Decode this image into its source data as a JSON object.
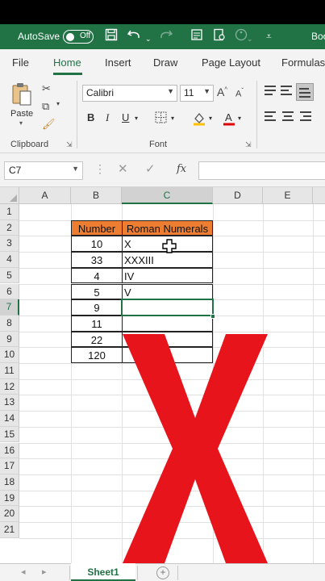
{
  "titlebar": {
    "autosave_label": "AutoSave",
    "toggle_label": "Off",
    "workbook_name": "Boo",
    "qa_icons": [
      "save-icon",
      "undo-icon",
      "redo-icon",
      "form-icon",
      "touch-mode-icon",
      "accessibility-icon",
      "customize-qat-icon"
    ]
  },
  "tabs": [
    {
      "label": "File"
    },
    {
      "label": "Home"
    },
    {
      "label": "Insert"
    },
    {
      "label": "Draw"
    },
    {
      "label": "Page Layout"
    },
    {
      "label": "Formulas"
    }
  ],
  "ribbon": {
    "clipboard": {
      "paste_label": "Paste",
      "group_label": "Clipboard"
    },
    "font": {
      "font_name": "Calibri",
      "font_size": "11",
      "bold": "B",
      "italic": "I",
      "underline": "U",
      "group_label": "Font"
    }
  },
  "formula_bar": {
    "name_box": "C7",
    "fx": "fx",
    "formula": ""
  },
  "columns": [
    "A",
    "B",
    "C",
    "D",
    "E"
  ],
  "rows": [
    "1",
    "2",
    "3",
    "4",
    "5",
    "6",
    "7",
    "8",
    "9",
    "10",
    "11",
    "12",
    "13",
    "14",
    "15",
    "16",
    "17",
    "18",
    "19",
    "20",
    "21"
  ],
  "table": {
    "header": {
      "number": "Number",
      "roman": "Roman Numerals"
    },
    "rows": [
      {
        "number": "10",
        "roman": "X"
      },
      {
        "number": "33",
        "roman": "XXXIII"
      },
      {
        "number": "4",
        "roman": "IV"
      },
      {
        "number": "5",
        "roman": "V"
      },
      {
        "number": "9",
        "roman": ""
      },
      {
        "number": "11",
        "roman": ""
      },
      {
        "number": "22",
        "roman": ""
      },
      {
        "number": "120",
        "roman": ""
      }
    ]
  },
  "sheets": [
    {
      "label": "Sheet1"
    }
  ],
  "colors": {
    "excel_green": "#217346",
    "header_fill": "#ed7d31",
    "overlay_x": "#e8141c"
  }
}
